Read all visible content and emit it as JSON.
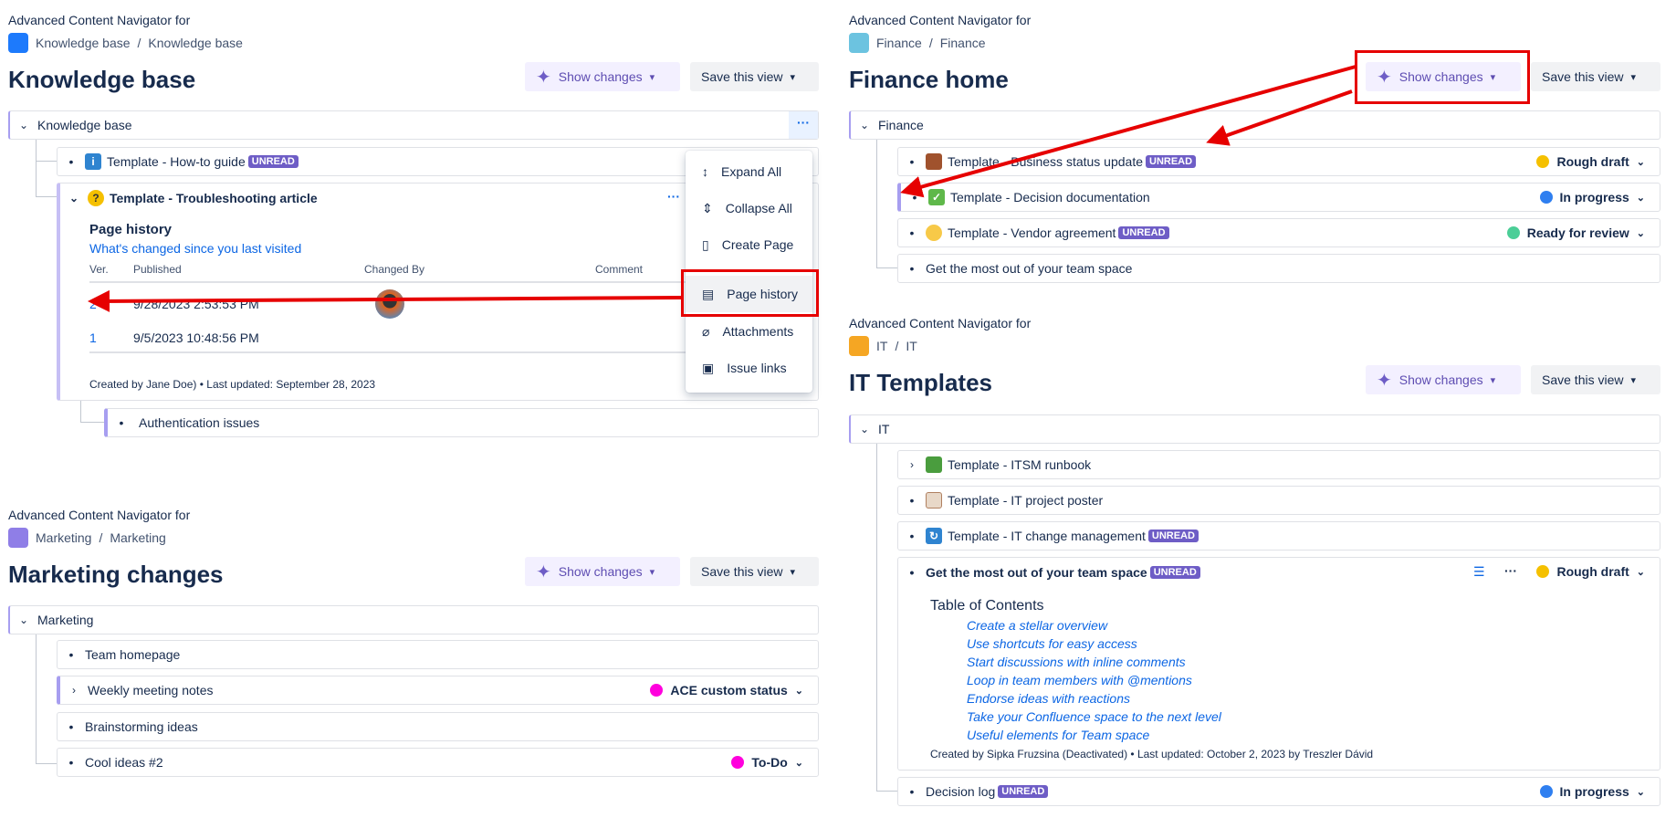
{
  "common": {
    "navigator_label": "Advanced Content Navigator for",
    "show_changes": "Show changes",
    "save_view": "Save this view",
    "unread": "UNREAD",
    "sep": "/"
  },
  "knowledge": {
    "breadcrumb": [
      "Knowledge base",
      "Knowledge base"
    ],
    "title": "Knowledge base",
    "root": "Knowledge base",
    "rows": [
      {
        "title": "Template - How-to guide",
        "unread": true
      }
    ],
    "expanded": {
      "title": "Template - Troubleshooting article",
      "history_title": "Page history",
      "history_link": "What's changed since you last visited",
      "columns": [
        "Ver.",
        "Published",
        "Changed By",
        "Comment"
      ],
      "versions": [
        {
          "ver": "2",
          "published": "9/28/2023 2:53:53 PM"
        },
        {
          "ver": "1",
          "published": "9/5/2023 10:48:56 PM"
        }
      ],
      "footer": "Created by Jane Doe)  •  Last updated: September 28, 2023"
    },
    "child": "Authentication issues",
    "menu": [
      "Expand All",
      "Collapse All",
      "Create Page",
      "Page history",
      "Attachments",
      "Issue links"
    ]
  },
  "marketing": {
    "breadcrumb": [
      "Marketing",
      "Marketing"
    ],
    "title": "Marketing changes",
    "root": "Marketing",
    "rows": [
      {
        "title": "Team homepage"
      },
      {
        "title": "Weekly meeting notes",
        "status": "ACE custom status",
        "color": "#ff00dd"
      },
      {
        "title": "Brainstorming ideas"
      },
      {
        "title": "Cool ideas #2",
        "status": "To-Do",
        "color": "#ff00dd"
      }
    ]
  },
  "finance": {
    "breadcrumb": [
      "Finance",
      "Finance"
    ],
    "title": "Finance home",
    "root": "Finance",
    "rows": [
      {
        "title": "Template - Business status update",
        "status": "Rough draft",
        "color": "#f5c000"
      },
      {
        "title": "Template - Decision documentation",
        "status": "In progress",
        "color": "#2f7ff0"
      },
      {
        "title": "Template - Vendor agreement",
        "status": "Ready for review",
        "color": "#4bce97"
      },
      {
        "title": "Get the most out of your team space"
      }
    ]
  },
  "it": {
    "breadcrumb": [
      "IT",
      "IT"
    ],
    "title": "IT Templates",
    "root": "IT",
    "rows": [
      {
        "title": "Template - ITSM runbook"
      },
      {
        "title": "Template - IT project poster"
      },
      {
        "title": "Template - IT change management"
      }
    ],
    "expanded": {
      "title": "Get the most out of your team space",
      "status": "Rough draft",
      "color": "#f5c000",
      "toc_title": "Table of Contents",
      "toc": [
        "Create a stellar overview",
        "Use shortcuts for easy access",
        "Start discussions with inline comments",
        "Loop in team members with @mentions",
        "Endorse ideas with reactions",
        "Take your Confluence space to the next level",
        "Useful elements for Team space"
      ],
      "footer": "Created by Sipka Fruzsina (Deactivated)  •  Last updated: October 2, 2023 by Treszler Dávid"
    },
    "last": {
      "title": "Decision log",
      "status": "In progress",
      "color": "#2f7ff0"
    }
  }
}
